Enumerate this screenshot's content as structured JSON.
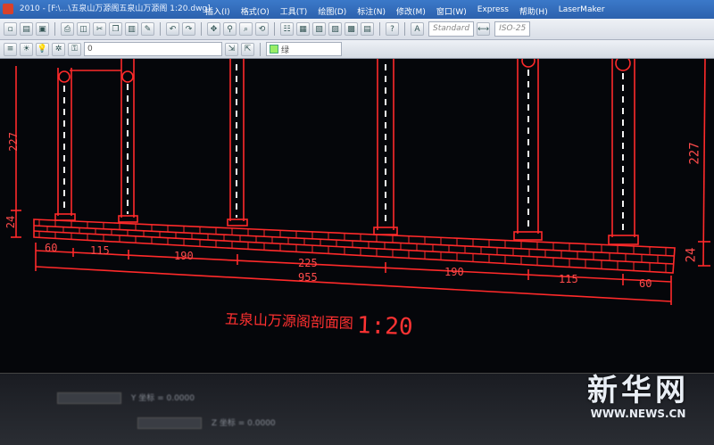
{
  "window": {
    "title": "2010 - [F:\\...\\五泉山万源阁五泉山万源阁 1:20.dwg]"
  },
  "menu": {
    "items": [
      {
        "label": "插入(I)"
      },
      {
        "label": "格式(O)"
      },
      {
        "label": "工具(T)"
      },
      {
        "label": "绘图(D)"
      },
      {
        "label": "标注(N)"
      },
      {
        "label": "修改(M)"
      },
      {
        "label": "窗口(W)"
      },
      {
        "label": "Express"
      },
      {
        "label": "帮助(H)"
      },
      {
        "label": "LaserMaker"
      }
    ]
  },
  "toolbar": {
    "text_style": "Standard",
    "dim_style_label": "ISO-25",
    "layer_name": "0",
    "layer_color_label": "绿"
  },
  "drawing": {
    "line_color": "#ff2a2a",
    "bg_color": "#05060a",
    "dimension_227_left": "227",
    "dimension_227_right": "227",
    "dimension_24_left": "24",
    "dimension_24_right": "24",
    "spans": [
      "60",
      "115",
      "190",
      "225",
      "190",
      "115",
      "60"
    ],
    "total_length": "955",
    "caption": "五泉山万源阁剖面图",
    "scale": "1:20"
  },
  "command_line": {
    "row1": "Y 坐标 = 0.0000",
    "row2": "Z 坐标 = 0.0000"
  },
  "watermark": {
    "cn": "新华网",
    "en": "WWW.NEWS.CN"
  }
}
